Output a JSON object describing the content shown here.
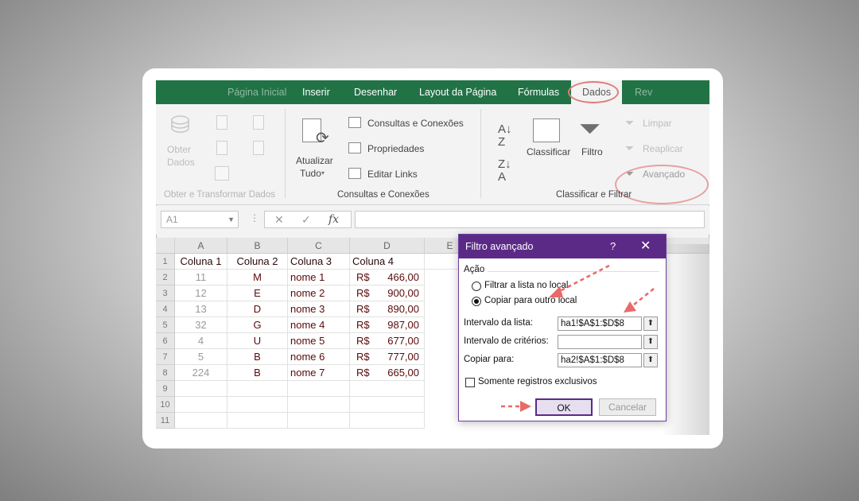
{
  "ribbon": {
    "tabs": [
      {
        "label": "Página Inicial",
        "state": "faded"
      },
      {
        "label": "Inserir",
        "state": "normal"
      },
      {
        "label": "Desenhar",
        "state": "normal"
      },
      {
        "label": "Layout da Página",
        "state": "normal"
      },
      {
        "label": "Fórmulas",
        "state": "normal"
      },
      {
        "label": "Dados",
        "state": "active"
      },
      {
        "label": "Rev",
        "state": "faded"
      }
    ],
    "groups": {
      "obter": {
        "label": "Obter e Transformar Dados",
        "btn1": "Obter",
        "btn2": "Dados"
      },
      "consultas": {
        "label": "Consultas e Conexões",
        "atualizar_line1": "Atualizar",
        "atualizar_line2": "Tudo",
        "items": [
          "Consultas e Conexões",
          "Propriedades",
          "Editar Links"
        ]
      },
      "classificar": {
        "label": "Classificar e Filtrar",
        "classificar": "Classificar",
        "filtro": "Filtro",
        "limpar": "Limpar",
        "reaplicar": "Reaplicar",
        "avancado": "Avançado"
      }
    },
    "accent_color": "#217346"
  },
  "formula_bar": {
    "name_box": "A1",
    "buttons": [
      "✕",
      "✓",
      "fx"
    ],
    "value": ""
  },
  "sheet": {
    "columns": [
      "A",
      "B",
      "C",
      "D",
      "E"
    ],
    "row_numbers": [
      "1",
      "2",
      "3",
      "4",
      "5",
      "6",
      "7",
      "8",
      "9",
      "10",
      "11"
    ],
    "header": [
      "Coluna 1",
      "Coluna 2",
      "Coluna 3",
      "Coluna 4"
    ],
    "rows": [
      {
        "a": "11",
        "b": "M",
        "c": "nome 1",
        "cur": "R$",
        "d": "466,00"
      },
      {
        "a": "12",
        "b": "E",
        "c": "nome 2",
        "cur": "R$",
        "d": "900,00"
      },
      {
        "a": "13",
        "b": "D",
        "c": "nome 3",
        "cur": "R$",
        "d": "890,00"
      },
      {
        "a": "32",
        "b": "G",
        "c": "nome 4",
        "cur": "R$",
        "d": "987,00"
      },
      {
        "a": "4",
        "b": "U",
        "c": "nome 5",
        "cur": "R$",
        "d": "677,00"
      },
      {
        "a": "5",
        "b": "B",
        "c": "nome 6",
        "cur": "R$",
        "d": "777,00"
      },
      {
        "a": "224",
        "b": "B",
        "c": "nome 7",
        "cur": "R$",
        "d": "665,00"
      }
    ]
  },
  "dialog": {
    "title": "Filtro avançado",
    "help": "?",
    "close": "✕",
    "section": "Ação",
    "option1": "Filtrar a lista no local",
    "option2": "Copiar para outro local",
    "selected_option": 2,
    "list_range_label": "Intervalo da lista:",
    "list_range_value": "ha1!$A$1:$D$8",
    "criteria_label": "Intervalo de critérios:",
    "criteria_value": "",
    "copy_to_label": "Copiar para:",
    "copy_to_value": "ha2!$A$1:$D$8",
    "unique_label": "Somente registros exclusivos",
    "unique_checked": false,
    "ok": "OK",
    "cancel": "Cancelar",
    "title_color": "#5b2a86"
  },
  "annotation_color": "#e86a6a"
}
